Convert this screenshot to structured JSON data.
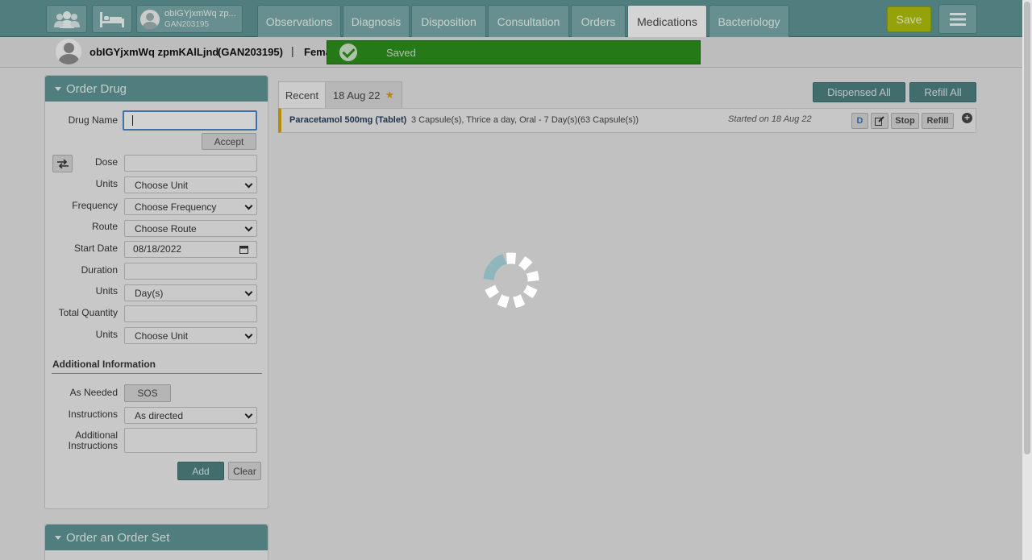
{
  "header": {
    "nav_icons": [
      "users-icon",
      "bed-icon"
    ],
    "patient_chip": {
      "name": "obIGYjxmWq zp...",
      "id": "GAN203195"
    },
    "tabs": [
      {
        "label": "Observations"
      },
      {
        "label": "Diagnosis"
      },
      {
        "label": "Disposition"
      },
      {
        "label": "Consultation"
      },
      {
        "label": "Orders"
      },
      {
        "label": "Medications",
        "active": true
      },
      {
        "label": "Bacteriology"
      }
    ],
    "save_label": "Save",
    "menu_icon": "hamburger-icon"
  },
  "patient_bar": {
    "name": "obIGYjxmWq zpmKAlLjnd",
    "id": "(GAN203195)",
    "separator": "|",
    "gender": "Fema"
  },
  "toast": {
    "message": "Saved",
    "icon": "check-circle-icon",
    "color": "#2b8a1a"
  },
  "order_drug": {
    "title": "Order Drug",
    "drug_name_label": "Drug Name",
    "drug_name_value": "",
    "accept_label": "Accept",
    "swap_icon": "swap-icon",
    "dose_label": "Dose",
    "units_label": "Units",
    "units_value": "Choose Unit",
    "frequency_label": "Frequency",
    "frequency_value": "Choose Frequency",
    "route_label": "Route",
    "route_value": "Choose Route",
    "start_date_label": "Start Date",
    "start_date_value": "08/18/2022",
    "duration_label": "Duration",
    "duration_units_label": "Units",
    "duration_units_value": "Day(s)",
    "total_quantity_label": "Total Quantity",
    "quantity_units_label": "Units",
    "quantity_units_value": "Choose Unit",
    "additional_info_title": "Additional Information",
    "as_needed_label": "As Needed",
    "sos_label": "SOS",
    "instructions_label": "Instructions",
    "instructions_value": "As directed",
    "additional_instructions_label_1": "Additional",
    "additional_instructions_label_2": "Instructions",
    "add_label": "Add",
    "clear_label": "Clear"
  },
  "order_set": {
    "title": "Order an Order Set"
  },
  "medications": {
    "tabs": [
      {
        "label": "Recent",
        "active": true
      },
      {
        "label": "18 Aug 22",
        "starred": true
      }
    ],
    "dispensed_all_label": "Dispensed All",
    "refill_all_label": "Refill All",
    "rows": [
      {
        "drug": "Paracetamol 500mg (Tablet)",
        "detail": "3 Capsule(s), Thrice a day, Oral - 7 Day(s)(63 Capsule(s))",
        "started": "Started on 18 Aug 22",
        "d_label": "D",
        "edit_icon": "edit-icon",
        "stop_label": "Stop",
        "refill_label": "Refill",
        "more_icon": "plus-circle-icon"
      }
    ]
  },
  "spinner": {
    "icon": "loading-spinner-icon"
  },
  "colors": {
    "brand": "#5c8f8f",
    "save": "#aab90b",
    "accent": "#d59a0a"
  }
}
